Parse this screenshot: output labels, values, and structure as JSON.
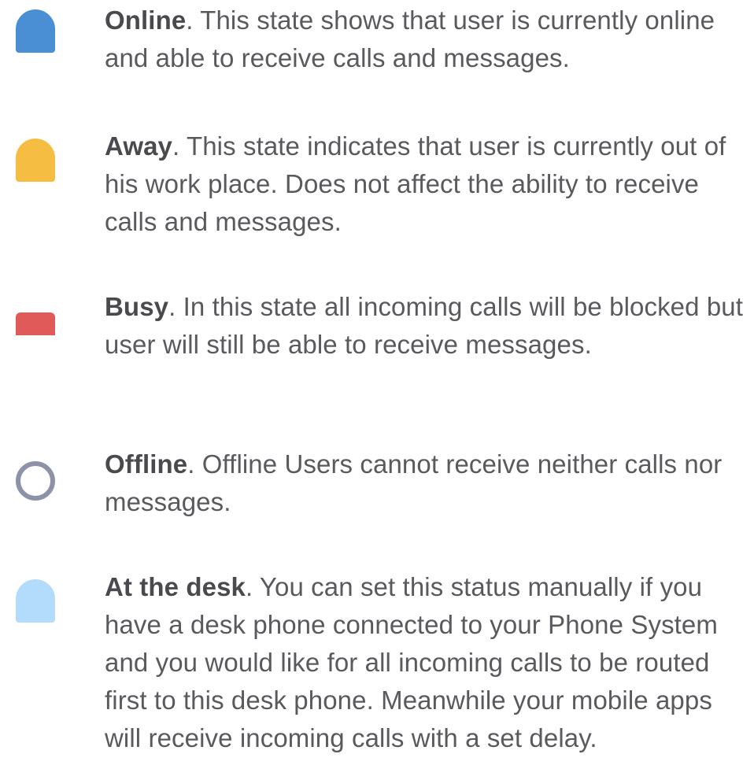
{
  "statuses": [
    {
      "name": "Online",
      "description": ". This state shows that user is currently online and able to receive calls and messages.",
      "icon": "online-status-icon",
      "color": "#4a8fd3"
    },
    {
      "name": "Away",
      "description": ". This state indicates that user is currently out of his work place. Does not affect the ability to receive calls and messages.",
      "icon": "away-status-icon",
      "color": "#f6bd43"
    },
    {
      "name": "Busy",
      "description": ". In this state all incoming calls will be blocked but user will still be able to receive messages.",
      "icon": "busy-status-icon",
      "color": "#e05a5a"
    },
    {
      "name": "Offline",
      "description": ". Offline Users cannot receive neither calls nor messages.",
      "icon": "offline-status-icon",
      "color": "#8e92a8"
    },
    {
      "name": "At the desk",
      "description": ". You can set this status manually if you have a desk phone connected to your Phone System and you would like for all incoming calls to be routed first to this desk phone. Meanwhile your mobile apps will receive incoming calls with a set delay.",
      "icon": "at-desk-status-icon",
      "color": "#b3dbfb"
    }
  ]
}
